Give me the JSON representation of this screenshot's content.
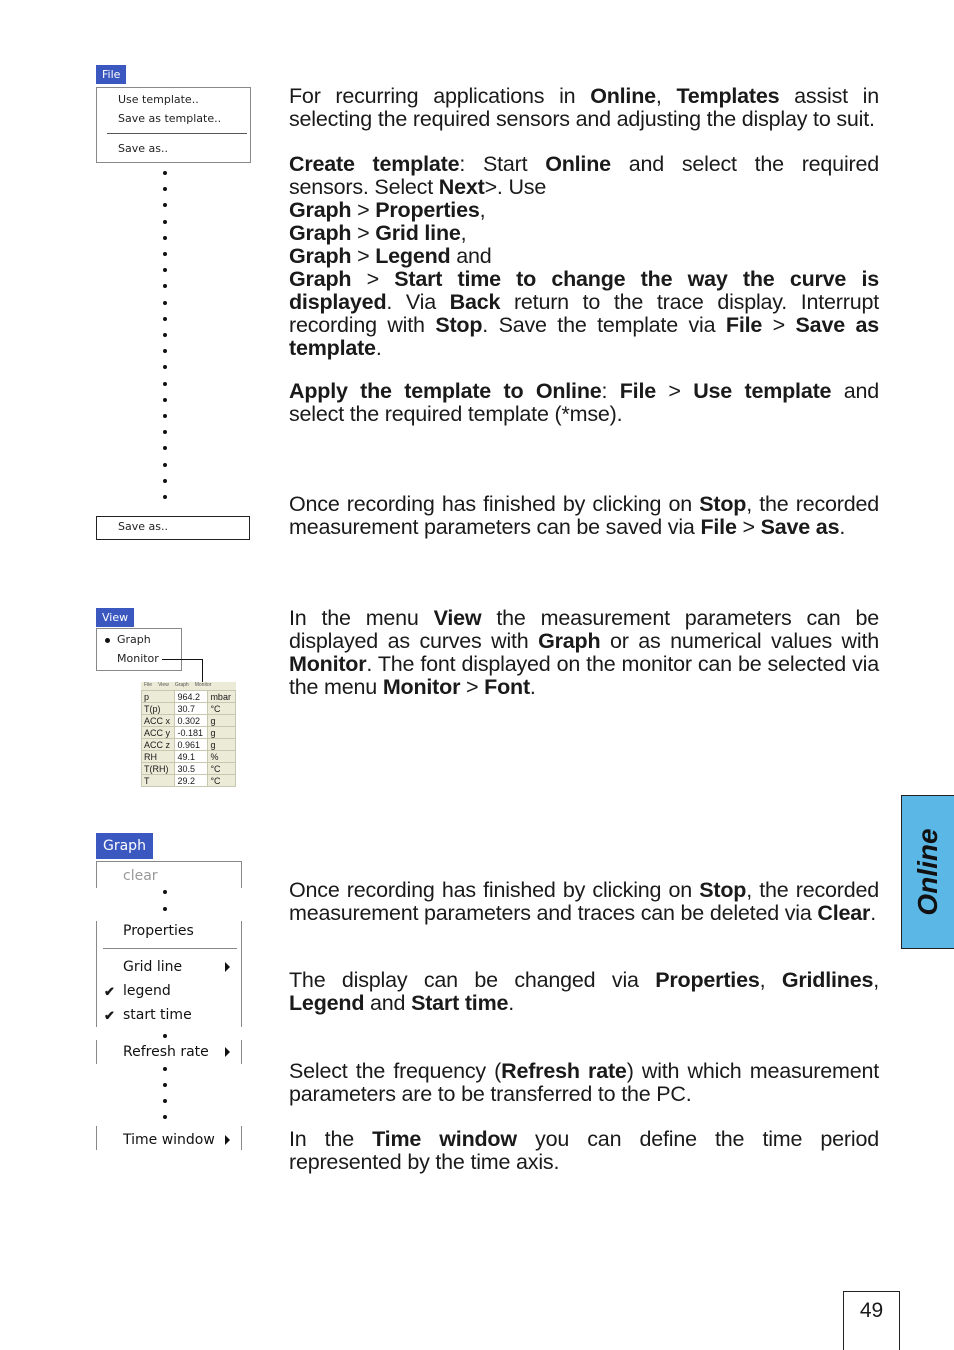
{
  "file_menu": {
    "tab": "File",
    "items": [
      "Use template..",
      "Save as template..",
      "Save as.."
    ],
    "save_as_box": "Save as.."
  },
  "view_menu": {
    "tab": "View",
    "items": [
      "Graph",
      "Monitor"
    ],
    "monitor_window": {
      "menubar": [
        "File",
        "View",
        "Graph",
        "Monitor"
      ],
      "rows": [
        [
          "p",
          "964.2",
          "mbar"
        ],
        [
          "T(p)",
          "30.7",
          "°C"
        ],
        [
          "ACC x",
          "0.302",
          "g"
        ],
        [
          "ACC y",
          "-0.181",
          "g"
        ],
        [
          "ACC z",
          "0.961",
          "g"
        ],
        [
          "RH",
          "49.1",
          "%"
        ],
        [
          "T(RH)",
          "30.5",
          "°C"
        ],
        [
          "T",
          "29.2",
          "°C"
        ]
      ]
    }
  },
  "graph_menu": {
    "tab": "Graph",
    "clear": "clear",
    "properties": "Properties",
    "grid_line": "Grid line",
    "legend": "legend",
    "start_time": "start time",
    "refresh_rate": "Refresh rate",
    "time_window": "Time window"
  },
  "paragraphs": [
    [
      {
        "t": "For recurring applications in "
      },
      {
        "t": "Online",
        "b": true
      },
      {
        "t": ", "
      },
      {
        "t": "Templates",
        "b": true
      },
      {
        "t": " assist in selecting the required sensors and adjusting the display to suit."
      }
    ],
    [
      {
        "t": "Create template",
        "b": true
      },
      {
        "t": ": Start "
      },
      {
        "t": "Online",
        "b": true
      },
      {
        "t": " and select the required sensors. Select "
      },
      {
        "t": "Next",
        "b": true
      },
      {
        "t": ">. Use"
      },
      {
        "br": true
      },
      {
        "t": "Graph",
        "b": true
      },
      {
        "t": " > "
      },
      {
        "t": "Properties",
        "b": true
      },
      {
        "t": ","
      },
      {
        "br": true
      },
      {
        "t": "Graph",
        "b": true
      },
      {
        "t": " > "
      },
      {
        "t": "Grid line",
        "b": true
      },
      {
        "t": ","
      },
      {
        "br": true
      },
      {
        "t": "Graph",
        "b": true
      },
      {
        "t": " > "
      },
      {
        "t": "Legend",
        "b": true
      },
      {
        "t": " and"
      },
      {
        "br": true
      },
      {
        "t": "Graph",
        "b": true
      },
      {
        "t": " > "
      },
      {
        "t": "Start time to change the way the curve is displayed",
        "b": true
      },
      {
        "t": ". Via "
      },
      {
        "t": "Back",
        "b": true
      },
      {
        "t": " return to the trace display. Interrupt recording with "
      },
      {
        "t": "Stop",
        "b": true
      },
      {
        "t": ". Save the template via "
      },
      {
        "t": "File",
        "b": true
      },
      {
        "t": " > "
      },
      {
        "t": "Save as template",
        "b": true
      },
      {
        "t": "."
      }
    ],
    [
      {
        "t": "Apply the template to Online",
        "b": true
      },
      {
        "t": ": "
      },
      {
        "t": "File",
        "b": true
      },
      {
        "t": " > "
      },
      {
        "t": "Use template",
        "b": true
      },
      {
        "t": " and select the required template (*mse)."
      }
    ],
    [
      {
        "t": "Once recording has finished by clicking on "
      },
      {
        "t": "Stop",
        "b": true
      },
      {
        "t": ", the recorded measurement parameters can be saved via "
      },
      {
        "t": "File",
        "b": true
      },
      {
        "t": " > "
      },
      {
        "t": "Save as",
        "b": true
      },
      {
        "t": "."
      }
    ],
    [
      {
        "t": "In the menu "
      },
      {
        "t": "View",
        "b": true
      },
      {
        "t": " the measurement parameters can be displayed as curves with "
      },
      {
        "t": "Graph",
        "b": true
      },
      {
        "t": " or as numerical values with "
      },
      {
        "t": "Monitor",
        "b": true
      },
      {
        "t": ". The font displayed on the monitor can be selected via the menu "
      },
      {
        "t": "Monitor",
        "b": true
      },
      {
        "t": " > "
      },
      {
        "t": "Font",
        "b": true
      },
      {
        "t": "."
      }
    ],
    [
      {
        "t": "Once recording has finished by clicking on "
      },
      {
        "t": "Stop",
        "b": true
      },
      {
        "t": ", the recorded measurement parameters and traces can be deleted via "
      },
      {
        "t": "Clear",
        "b": true
      },
      {
        "t": "."
      }
    ],
    [
      {
        "t": "The display can be changed via "
      },
      {
        "t": "Properties",
        "b": true
      },
      {
        "t": ", "
      },
      {
        "t": "Gridlines",
        "b": true
      },
      {
        "t": ", "
      },
      {
        "t": "Legend",
        "b": true
      },
      {
        "t": " and "
      },
      {
        "t": "Start time",
        "b": true
      },
      {
        "t": "."
      }
    ],
    [
      {
        "t": "Select the frequency ("
      },
      {
        "t": "Refresh rate",
        "b": true
      },
      {
        "t": ") with which measurement parameters are to be transferred to the PC."
      }
    ],
    [
      {
        "t": "In the "
      },
      {
        "t": "Time window",
        "b": true
      },
      {
        "t": " you can define the time period represented by the time axis."
      }
    ]
  ],
  "side_tab": {
    "label": "Online",
    "color": "#5bb8e6"
  },
  "page_number": "49",
  "colors": {
    "menu_tab": "#3a58c0"
  }
}
